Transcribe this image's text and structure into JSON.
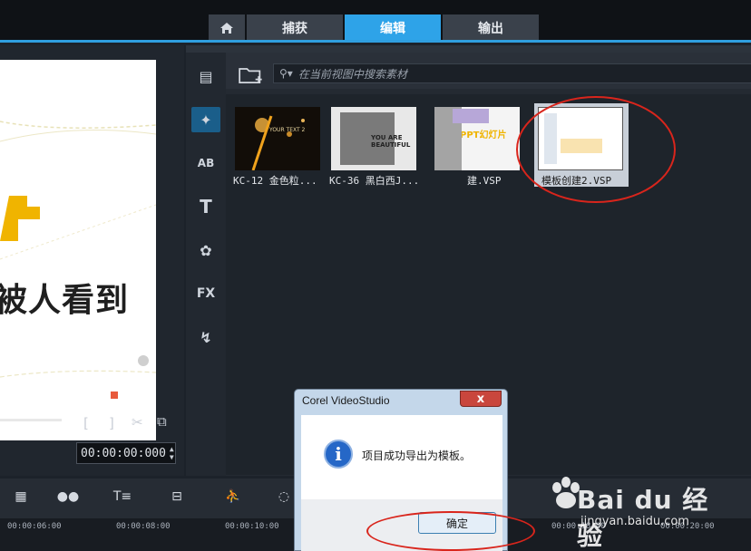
{
  "tabs": [
    {
      "icon": "home-icon"
    },
    {
      "label": "捕获"
    },
    {
      "label": "编辑"
    },
    {
      "label": "输出"
    }
  ],
  "preview": {
    "overlay_text": "被人看到",
    "timecode": "00:00:00:000"
  },
  "library": {
    "search_placeholder": "在当前视图中搜索素材",
    "side_icons": [
      "media-icon",
      "instant-project-icon",
      "transition-icon",
      "title-icon",
      "graphic-icon",
      "filter-icon",
      "path-icon"
    ],
    "side_labels": {
      "transition": "AB",
      "title": "T",
      "filter": "FX"
    },
    "thumbnails": [
      {
        "label": "KC-12 金色粒...",
        "caption": "YOUR TEXT 2",
        "selected": false
      },
      {
        "label": "KC-36 黑白西J...",
        "caption": "YOU ARE BEAUTIFUL",
        "selected": false
      },
      {
        "label": "建.VSP",
        "caption": "PPT幻灯片",
        "selected": false
      },
      {
        "label": "模板创建2.VSP",
        "caption": "",
        "selected": true
      }
    ]
  },
  "timeline": {
    "ruler": [
      "00:00:06:00",
      "00:00:08:00",
      "00:00:10:00",
      "00:00:18:00",
      "00:00:20:00"
    ]
  },
  "dialog": {
    "title": "Corel VideoStudio",
    "message": "项目成功导出为模板。",
    "ok_label": "确定",
    "close_label": "x"
  },
  "watermark": {
    "brand": "Bai du 经验",
    "url": "jingyan.baidu.com"
  },
  "colors": {
    "accent": "#2ea3e8",
    "annotation": "#d9251c"
  }
}
